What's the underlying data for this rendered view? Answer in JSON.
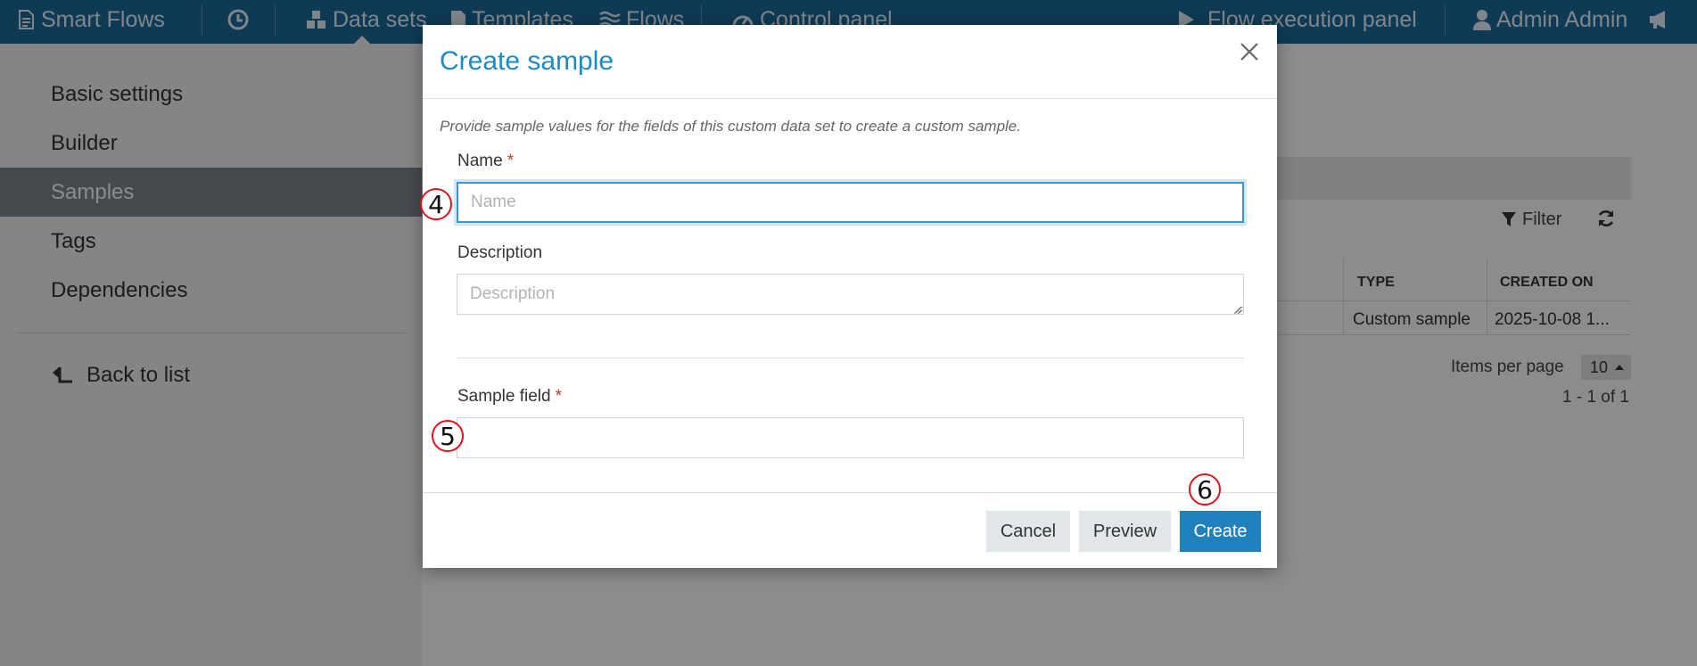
{
  "nav": {
    "brand": "Smart Flows",
    "data_sets": "Data sets",
    "templates": "Templates",
    "flows": "Flows",
    "control_panel": "Control panel",
    "flow_execution_panel": "Flow execution panel",
    "user": "Admin Admin"
  },
  "sidebar": {
    "items": [
      {
        "label": "Basic settings"
      },
      {
        "label": "Builder"
      },
      {
        "label": "Samples"
      },
      {
        "label": "Tags"
      },
      {
        "label": "Dependencies"
      }
    ],
    "active_index": 2,
    "back_label": "Back to list"
  },
  "list": {
    "filter_label": "Filter",
    "columns": [
      "TYPE",
      "CREATED ON"
    ],
    "rows": [
      {
        "type": "Custom sample",
        "created_on": "2025-10-08 1..."
      }
    ],
    "items_per_page_label": "Items per page",
    "items_per_page_value": "10",
    "range_text": "1 - 1 of 1"
  },
  "modal": {
    "title": "Create sample",
    "description": "Provide sample values for the fields of this custom data set to create a custom sample.",
    "name_label": "Name",
    "name_required": "*",
    "name_placeholder": "Name",
    "name_value": "",
    "description_label": "Description",
    "description_placeholder": "Description",
    "sample_field_label": "Sample field",
    "sample_field_required": "*",
    "sample_field_value": "",
    "buttons": {
      "cancel": "Cancel",
      "preview": "Preview",
      "create": "Create"
    }
  },
  "markers": [
    "4",
    "5",
    "6"
  ],
  "colors": {
    "navbar": "#1b6b9c",
    "accent": "#1f8ac0",
    "primary_button": "#1f81bd",
    "required": "#d9342b",
    "marker_ring": "#e0121b"
  }
}
